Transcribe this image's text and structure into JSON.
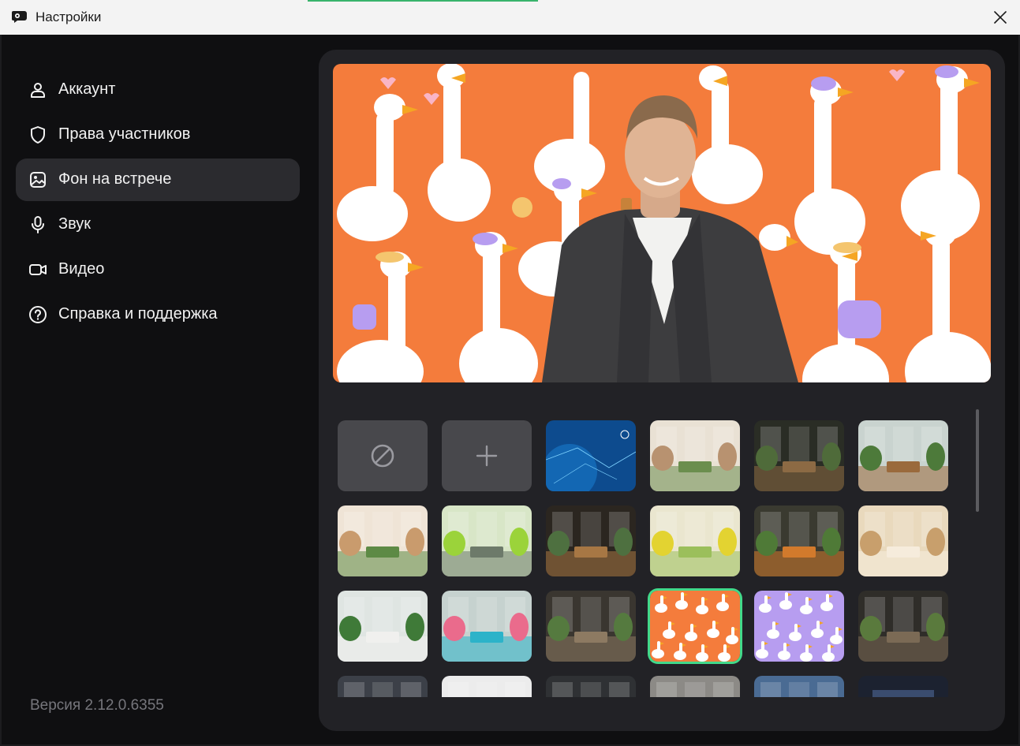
{
  "window": {
    "title": "Настройки"
  },
  "nav": [
    {
      "id": "account",
      "label": "Аккаунт",
      "icon": "person-icon",
      "active": false
    },
    {
      "id": "participants",
      "label": "Права участников",
      "icon": "shield-icon",
      "active": false
    },
    {
      "id": "background",
      "label": "Фон на встрече",
      "icon": "image-icon",
      "active": true
    },
    {
      "id": "sound",
      "label": "Звук",
      "icon": "microphone-icon",
      "active": false
    },
    {
      "id": "video",
      "label": "Видео",
      "icon": "camera-icon",
      "active": false
    },
    {
      "id": "help",
      "label": "Справка и поддержка",
      "icon": "question-circle-icon",
      "active": false
    }
  ],
  "version": "Версия 2.12.0.6355",
  "backgrounds": {
    "selected_index": 15,
    "tiles": [
      {
        "kind": "none",
        "icon": "no-background-icon"
      },
      {
        "kind": "add",
        "icon": "plus-icon"
      },
      {
        "kind": "image",
        "theme": "blue-tech"
      },
      {
        "kind": "image",
        "theme": "cafe-white"
      },
      {
        "kind": "image",
        "theme": "dark-green-cafe"
      },
      {
        "kind": "image",
        "theme": "greenhouse"
      },
      {
        "kind": "image",
        "theme": "cafe-warm"
      },
      {
        "kind": "image",
        "theme": "lime-hall"
      },
      {
        "kind": "image",
        "theme": "dark-bar"
      },
      {
        "kind": "image",
        "theme": "yellow-office"
      },
      {
        "kind": "image",
        "theme": "green-wall-lounge"
      },
      {
        "kind": "image",
        "theme": "beige-room"
      },
      {
        "kind": "image",
        "theme": "green-wall-office"
      },
      {
        "kind": "image",
        "theme": "colorful-chairs"
      },
      {
        "kind": "image",
        "theme": "dark-loft"
      },
      {
        "kind": "image",
        "theme": "geese-orange"
      },
      {
        "kind": "image",
        "theme": "geese-purple"
      },
      {
        "kind": "image",
        "theme": "dark-corridor"
      },
      {
        "kind": "image",
        "theme": "dark-windows"
      },
      {
        "kind": "image",
        "theme": "white-corridor"
      },
      {
        "kind": "image",
        "theme": "black-lamp-office"
      },
      {
        "kind": "image",
        "theme": "loft-lamps"
      },
      {
        "kind": "image",
        "theme": "blue-office"
      },
      {
        "kind": "image",
        "theme": "city-sunset"
      }
    ]
  },
  "colors": {
    "accent": "#42d98a",
    "preview_bg": "#f47c3c",
    "active_nav": "#2b2b2f"
  }
}
